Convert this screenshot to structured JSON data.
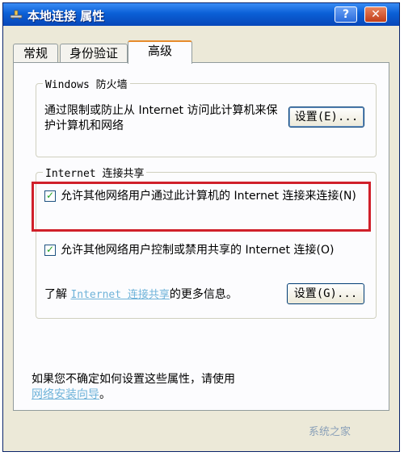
{
  "window": {
    "title": "本地连接 属性",
    "help_label": "?",
    "close_label": "✕"
  },
  "tabs": [
    {
      "label": "常规"
    },
    {
      "label": "身份验证"
    },
    {
      "label": "高级"
    }
  ],
  "firewall": {
    "legend": "Windows 防火墙",
    "description": "通过限制或防止从 Internet 访问此计算机来保护计算机和网络",
    "settings_label": "设置(E)..."
  },
  "ics": {
    "legend": "Internet 连接共享",
    "allow_connect_label": "允许其他网络用户通过此计算机的 Internet 连接来连接(N)",
    "allow_connect_checked": true,
    "allow_control_label": "允许其他网络用户控制或禁用共享的 Internet 连接(O)",
    "allow_control_checked": true,
    "learn_prefix": "了解",
    "learn_link": "Internet 连接共享",
    "learn_suffix": "的更多信息。",
    "settings_label": "设置(G)..."
  },
  "footer": {
    "text": "如果您不确定如何设置这些属性，请使用",
    "link": "网络安装向导",
    "text_end": "。"
  },
  "watermark": "系统之家"
}
